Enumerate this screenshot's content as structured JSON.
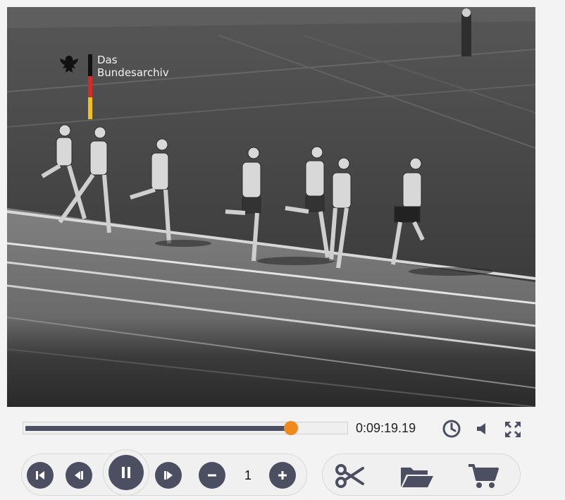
{
  "video": {
    "watermark": {
      "line1": "Das",
      "line2": "Bundesarchiv"
    }
  },
  "player": {
    "progress_fraction": 0.83,
    "time": "0:09:19.19",
    "playback_rate": "1"
  },
  "icons": {
    "clock": "clock-icon",
    "volume": "volume-icon",
    "fullscreen": "fullscreen-icon",
    "skip_start": "skip-start-icon",
    "step_back": "step-back-icon",
    "pause": "pause-icon",
    "step_forward": "step-forward-icon",
    "minus": "minus-icon",
    "plus": "plus-icon",
    "cut": "scissors-icon",
    "open": "folder-open-icon",
    "cart": "cart-icon"
  },
  "colors": {
    "accent": "#f08a1e",
    "button": "#4b4f61",
    "flag_black": "#111111",
    "flag_red": "#d42a2a",
    "flag_gold": "#f1c21b"
  }
}
